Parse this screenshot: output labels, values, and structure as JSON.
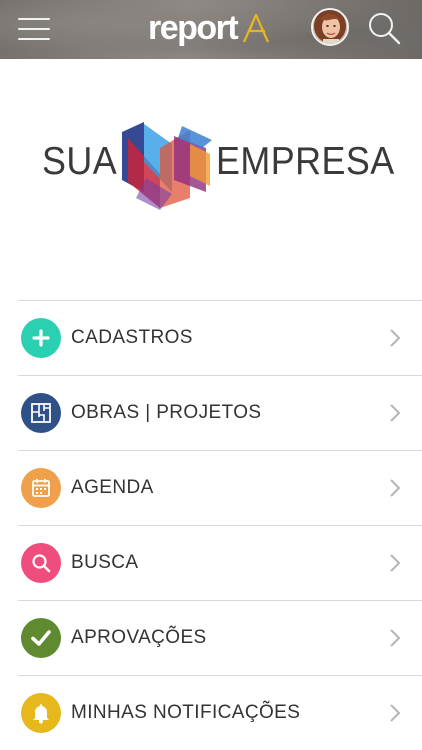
{
  "header": {
    "brand_name": "report",
    "brand_mark_color": "#e8b620",
    "background_color": "#7d7975"
  },
  "company_logo": {
    "text_left": "SUA",
    "text_right": "EMPRESA"
  },
  "menu": {
    "items": [
      {
        "label": "CADASTROS",
        "icon": "plus-icon",
        "color": "#2bd0b2"
      },
      {
        "label": "OBRAS | PROJETOS",
        "icon": "floorplan-icon",
        "color": "#2f5188"
      },
      {
        "label": "AGENDA",
        "icon": "calendar-icon",
        "color": "#f0a04b"
      },
      {
        "label": "BUSCA",
        "icon": "search-icon",
        "color": "#ef4d7e"
      },
      {
        "label": "APROVAÇÕES",
        "icon": "checkmark-icon",
        "color": "#5f8a2f"
      },
      {
        "label": "MINHAS NOTIFICAÇÕES",
        "icon": "bell-icon",
        "color": "#e7b81c"
      }
    ]
  }
}
